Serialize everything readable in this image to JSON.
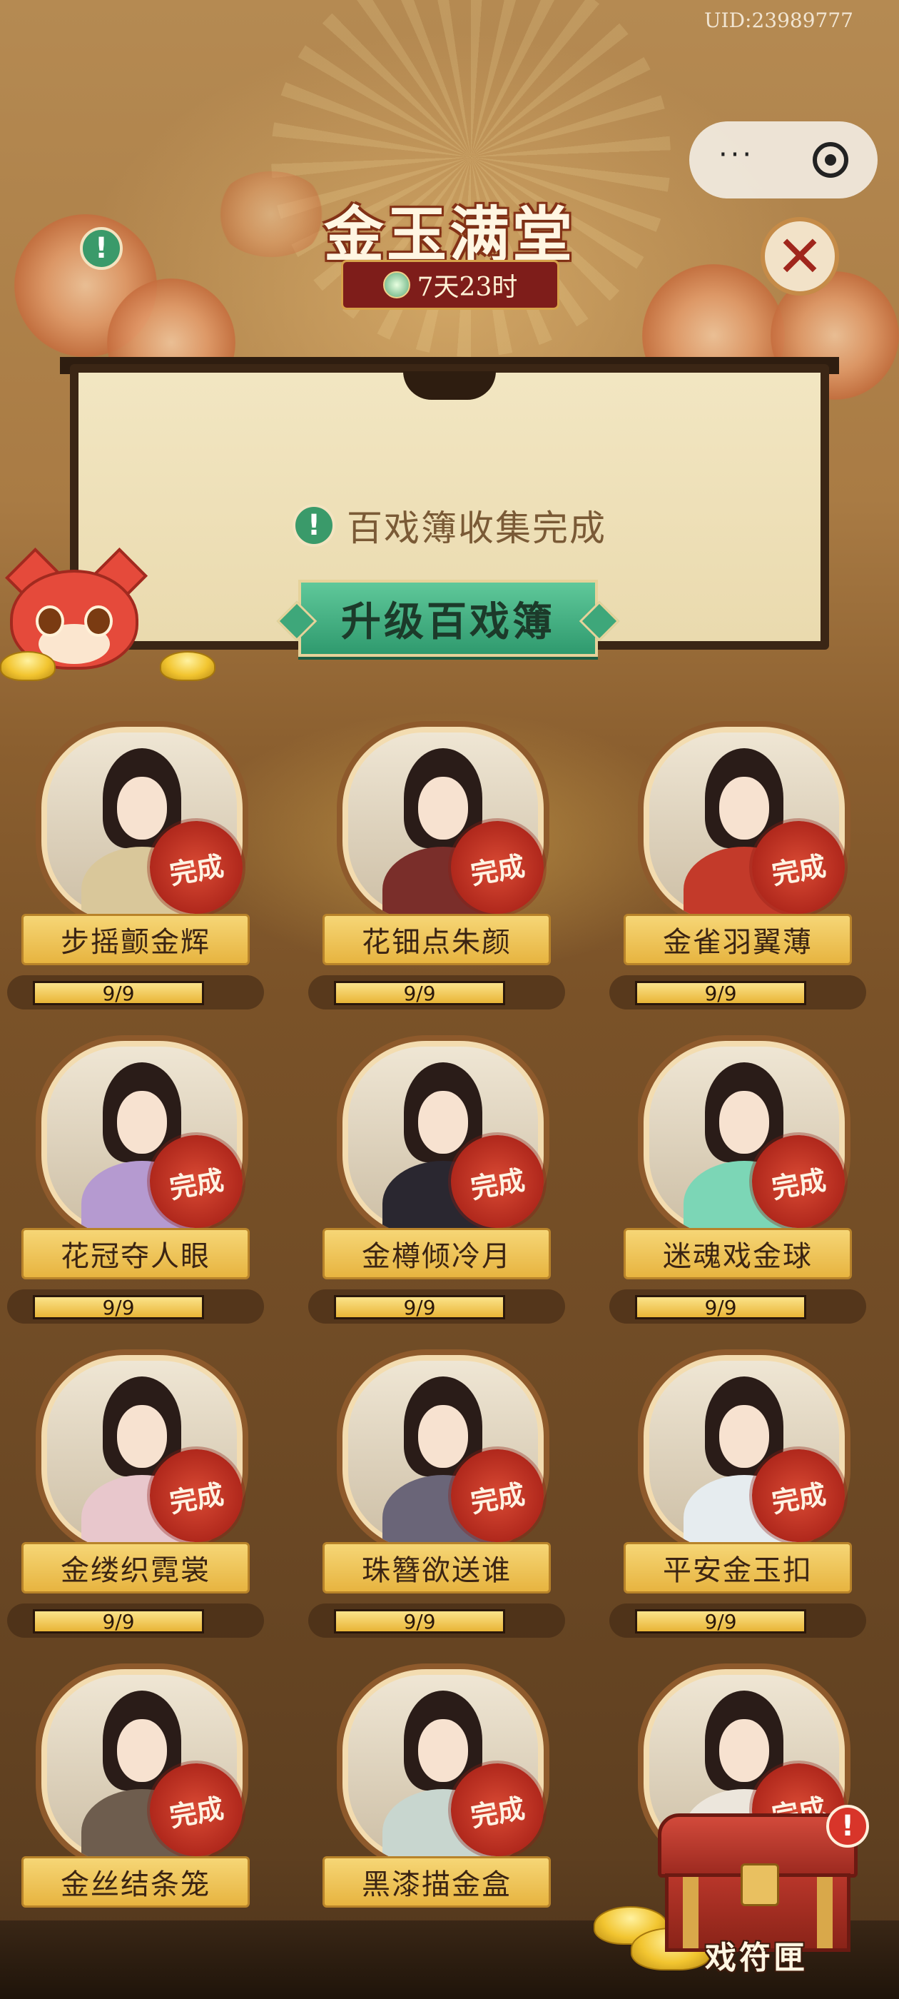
{
  "header": {
    "uid": "UID:23989777",
    "title": "金玉满堂",
    "timer": "7天23时"
  },
  "capsule": {
    "more": "···"
  },
  "panel": {
    "message": "百戏簿收集完成",
    "upgrade_button": "升级百戏簿"
  },
  "badges": {
    "alert": "!"
  },
  "close_symbol": "✕",
  "cards": [
    {
      "name": "步摇颤金辉",
      "progress": "9/9",
      "status": "完成",
      "fill": 1,
      "robe": "#d9c79a"
    },
    {
      "name": "花钿点朱颜",
      "progress": "9/9",
      "status": "完成",
      "fill": 1,
      "robe": "#7a2e2a"
    },
    {
      "name": "金雀羽翼薄",
      "progress": "9/9",
      "status": "完成",
      "fill": 1,
      "robe": "#c33a2a"
    },
    {
      "name": "花冠夺人眼",
      "progress": "9/9",
      "status": "完成",
      "fill": 1,
      "robe": "#b59ad0"
    },
    {
      "name": "金樽倾冷月",
      "progress": "9/9",
      "status": "完成",
      "fill": 1,
      "robe": "#2a2730"
    },
    {
      "name": "迷魂戏金球",
      "progress": "9/9",
      "status": "完成",
      "fill": 1,
      "robe": "#7cd6b6"
    },
    {
      "name": "金缕织霓裳",
      "progress": "9/9",
      "status": "完成",
      "fill": 1,
      "robe": "#e8c7cc"
    },
    {
      "name": "珠簪欲送谁",
      "progress": "9/9",
      "status": "完成",
      "fill": 1,
      "robe": "#6a6578"
    },
    {
      "name": "平安金玉扣",
      "progress": "9/9",
      "status": "完成",
      "fill": 1,
      "robe": "#e6ecef"
    },
    {
      "name": "金丝结条笼",
      "progress": "",
      "status": "完成",
      "fill": 0,
      "robe": "#6e5d4e"
    },
    {
      "name": "黑漆描金盒",
      "progress": "",
      "status": "完成",
      "fill": 0,
      "robe": "#c8d6cf"
    },
    {
      "name": "",
      "progress": "",
      "status": "完成",
      "fill": 0,
      "robe": "#ece6dc"
    }
  ],
  "chest": {
    "label": "戏符匣"
  }
}
